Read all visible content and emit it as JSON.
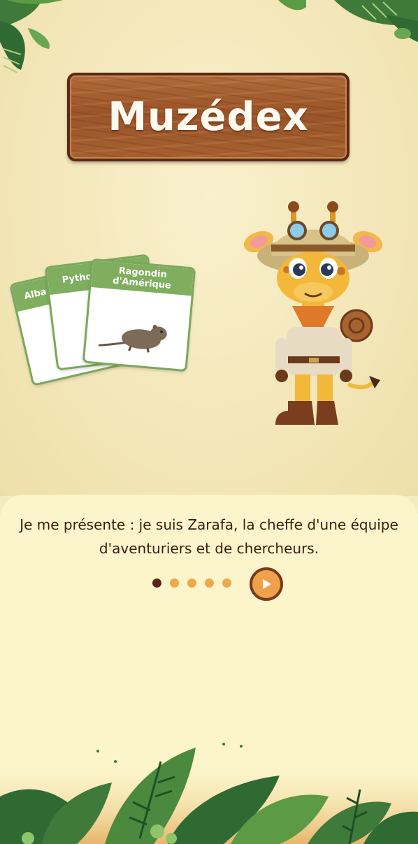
{
  "app": {
    "title": "Muzédex"
  },
  "cards": [
    {
      "label": "Alba"
    },
    {
      "label": "Pytho"
    },
    {
      "label": "Ragondin d'Amérique"
    }
  ],
  "intro": {
    "line1": "Je me présente : je suis Zarafa, la cheffe d'une équipe",
    "line2": "d'aventuriers et de chercheurs."
  },
  "pagination": {
    "total": 5,
    "current": 1
  },
  "icons": {
    "play": "play-icon",
    "mascot": "giraffe-explorer-mascot",
    "card_animal": "coypu-animal"
  },
  "colors": {
    "background": "#f5ebc2",
    "panel": "#fcf5cb",
    "card_green": "#7fae5e",
    "accent_orange": "#efa24a",
    "dark_brown": "#5a2314"
  }
}
